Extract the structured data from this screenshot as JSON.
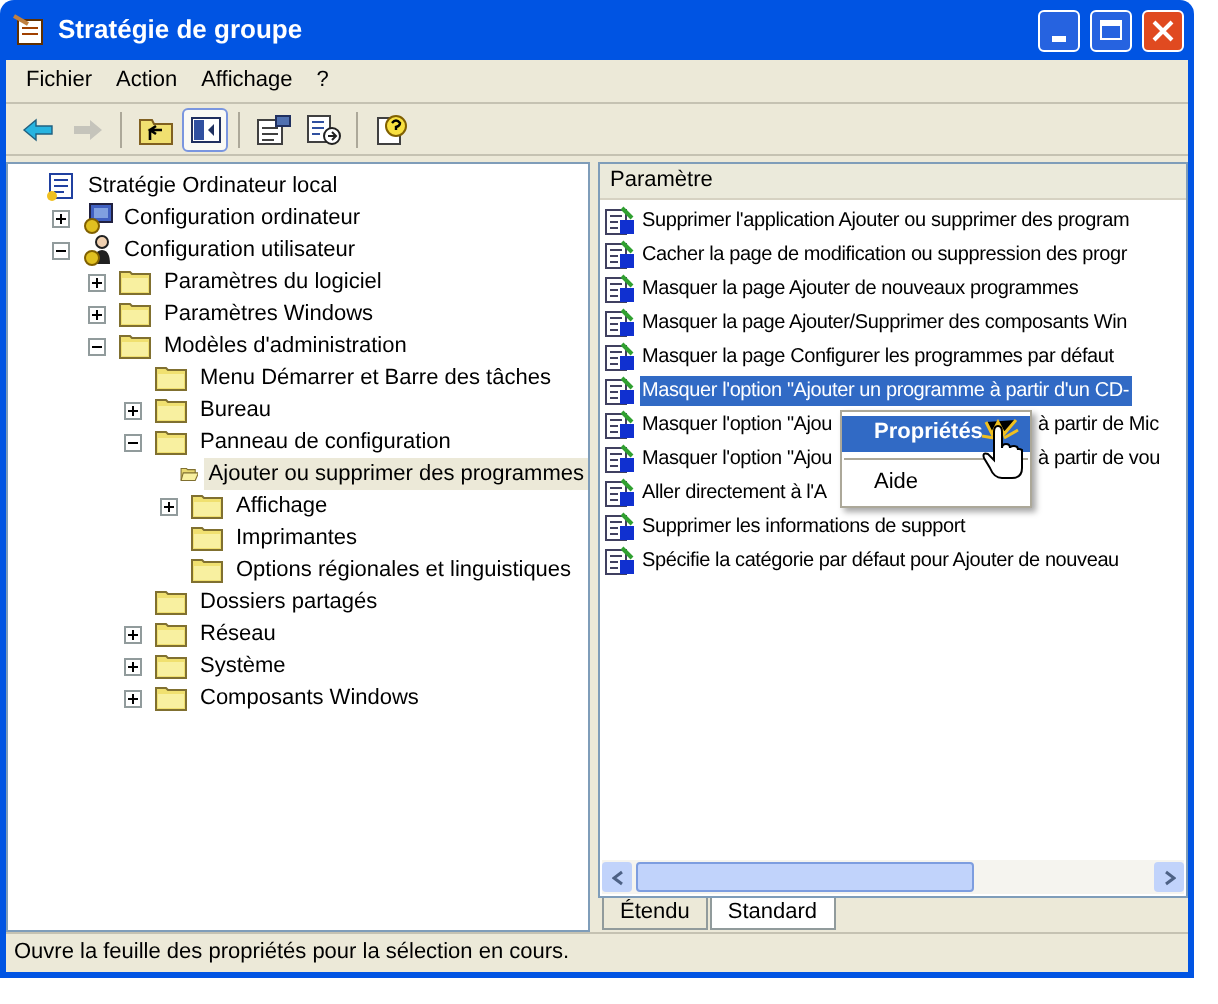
{
  "window": {
    "title": "Stratégie de groupe"
  },
  "menu": [
    "Fichier",
    "Action",
    "Affichage",
    "?"
  ],
  "toolbar": [
    {
      "kind": "back",
      "disabled": false,
      "pressed": false
    },
    {
      "kind": "forward",
      "disabled": true,
      "pressed": false
    },
    {
      "kind": "up",
      "disabled": false,
      "pressed": false
    },
    {
      "kind": "tree",
      "disabled": false,
      "pressed": true
    },
    {
      "kind": "properties",
      "disabled": false,
      "pressed": false
    },
    {
      "kind": "export",
      "disabled": false,
      "pressed": false
    },
    {
      "kind": "help",
      "disabled": false,
      "pressed": false
    }
  ],
  "tree": [
    {
      "label": "Stratégie Ordinateur local",
      "kind": "policy",
      "selected": false,
      "children": [
        {
          "label": "Configuration ordinateur",
          "kind": "computer",
          "expanded": false,
          "selected": false
        },
        {
          "label": "Configuration utilisateur",
          "kind": "user",
          "expanded": true,
          "selected": false,
          "children": [
            {
              "label": "Paramètres du logiciel",
              "kind": "folder",
              "expanded": false,
              "selected": false
            },
            {
              "label": "Paramètres Windows",
              "kind": "folder",
              "expanded": false,
              "selected": false
            },
            {
              "label": "Modèles d'administration",
              "kind": "folder",
              "expanded": true,
              "selected": false,
              "children": [
                {
                  "label": "Menu Démarrer et Barre des tâches",
                  "kind": "folder",
                  "selected": false
                },
                {
                  "label": "Bureau",
                  "kind": "folder",
                  "expanded": false,
                  "selected": false
                },
                {
                  "label": "Panneau de configuration",
                  "kind": "folder",
                  "expanded": true,
                  "selected": false,
                  "children": [
                    {
                      "label": "Ajouter ou supprimer des programmes",
                      "kind": "folder",
                      "selected": true
                    },
                    {
                      "label": "Affichage",
                      "kind": "folder",
                      "expanded": false,
                      "selected": false
                    },
                    {
                      "label": "Imprimantes",
                      "kind": "folder",
                      "selected": false
                    },
                    {
                      "label": "Options régionales et linguistiques",
                      "kind": "folder",
                      "selected": false
                    }
                  ]
                },
                {
                  "label": "Dossiers partagés",
                  "kind": "folder",
                  "selected": false
                },
                {
                  "label": "Réseau",
                  "kind": "folder",
                  "expanded": false,
                  "selected": false
                },
                {
                  "label": "Système",
                  "kind": "folder",
                  "expanded": false,
                  "selected": false
                },
                {
                  "label": "Composants Windows",
                  "kind": "folder",
                  "expanded": false,
                  "selected": false
                }
              ]
            }
          ]
        }
      ]
    }
  ],
  "list": {
    "column": "Paramètre",
    "rows": [
      {
        "text": "Supprimer l'application Ajouter ou supprimer des program",
        "selected": false
      },
      {
        "text": "Cacher la page de modification ou suppression des progr",
        "selected": false
      },
      {
        "text": "Masquer la page Ajouter de nouveaux programmes",
        "selected": false
      },
      {
        "text": "Masquer la page Ajouter/Supprimer des composants Win",
        "selected": false
      },
      {
        "text": "Masquer la page Configurer les programmes par défaut",
        "selected": false
      },
      {
        "text": "Masquer l'option \"Ajouter un programme à partir d'un CD-",
        "selected": true
      },
      {
        "text": "Masquer l'option \"Ajou",
        "tail": "à partir de Mic",
        "selected": false
      },
      {
        "text": "Masquer l'option \"Ajou",
        "tail": "à partir de vou",
        "selected": false
      },
      {
        "text": "Aller directement à l'A",
        "selected": false
      },
      {
        "text": "Supprimer les informations de support",
        "selected": false
      },
      {
        "text": "Spécifie la catégorie par défaut pour Ajouter de nouveau",
        "selected": false
      }
    ]
  },
  "context_menu": [
    {
      "label": "Propriétés",
      "selected": true
    },
    {
      "label": "Aide",
      "selected": false
    }
  ],
  "tabs": [
    {
      "label": "Étendu",
      "selected": false
    },
    {
      "label": "Standard",
      "selected": true
    }
  ],
  "status_bar": "Ouvre la feuille des propriétés pour la sélection en cours."
}
